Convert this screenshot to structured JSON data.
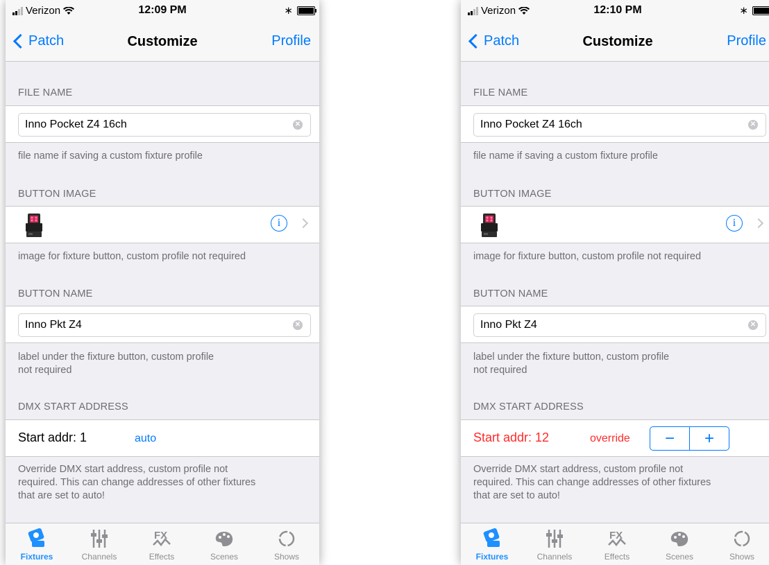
{
  "status_left": {
    "carrier": "Verizon",
    "time": "12:09 PM"
  },
  "status_right": {
    "carrier": "Verizon",
    "time": "12:10 PM"
  },
  "nav": {
    "back_label": "Patch",
    "title": "Customize",
    "right_label": "Profile"
  },
  "file_name": {
    "header": "FILE NAME",
    "value": "Inno Pocket Z4 16ch",
    "footer": "file name if saving a custom fixture profile"
  },
  "button_image": {
    "header": "BUTTON IMAGE",
    "footer": "image for fixture button, custom profile not required"
  },
  "button_name": {
    "header": "BUTTON NAME",
    "value": "Inno Pkt Z4",
    "footer_line1": "label under the fixture button, custom profile",
    "footer_line2": "not required"
  },
  "dmx": {
    "header": "DMX START ADDRESS",
    "left_start": "Start addr: 1",
    "left_mode": "auto",
    "right_start": "Start addr: 12",
    "right_mode": "override",
    "stepper_minus": "−",
    "stepper_plus": "+",
    "footer_line1": "Override DMX start address, custom profile not",
    "footer_line2": "required. This can change addresses of other fixtures",
    "footer_line3": "that are set to auto!"
  },
  "tabs": [
    {
      "label": "Fixtures",
      "icon": "fixtures-icon",
      "active": true
    },
    {
      "label": "Channels",
      "icon": "channels-icon",
      "active": false
    },
    {
      "label": "Effects",
      "icon": "effects-icon",
      "active": false
    },
    {
      "label": "Scenes",
      "icon": "scenes-icon",
      "active": false
    },
    {
      "label": "Shows",
      "icon": "shows-icon",
      "active": false
    }
  ],
  "colors": {
    "accent": "#007aff",
    "override": "#ff2a2a",
    "active_tab": "#1e90ff"
  }
}
